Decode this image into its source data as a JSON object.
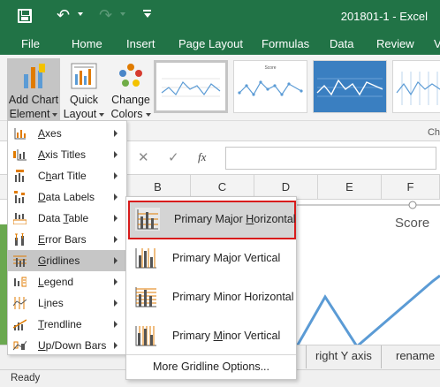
{
  "titlebar": {
    "doc_title": "201801-1 - Excel"
  },
  "tabs": [
    "File",
    "Home",
    "Insert",
    "Page Layout",
    "Formulas",
    "Data",
    "Review",
    "V"
  ],
  "ribbon": {
    "add_chart_line1": "Add Chart",
    "add_chart_line2": "Element",
    "quick_layout_line1": "Quick",
    "quick_layout_line2": "Layout",
    "change_colors_line1": "Change",
    "change_colors_line2": "Colors",
    "group_label_partial": "Ch",
    "chart_styles": [
      "style-1",
      "style-2",
      "style-3",
      "style-4"
    ],
    "style_thumb_title": "Score"
  },
  "formula_bar": {
    "cancel_symbol": "✕",
    "enter_symbol": "✓",
    "fx_label": "fx",
    "value": ""
  },
  "columns": [
    "B",
    "C",
    "D",
    "E",
    "F"
  ],
  "chart": {
    "title": "Score"
  },
  "sheet_tabs": [
    "right Y axis",
    "rename"
  ],
  "status": "Ready",
  "chart_element_menu": {
    "items": [
      {
        "label": "Axes",
        "mnemonic_index": 1
      },
      {
        "label": "Axis Titles",
        "mnemonic_index": 1
      },
      {
        "label": "Chart Title",
        "mnemonic_index": 1
      },
      {
        "label": "Data Labels",
        "mnemonic_index": 1
      },
      {
        "label": "Data Table",
        "mnemonic_index": 6
      },
      {
        "label": "Error Bars",
        "mnemonic_index": 1
      },
      {
        "label": "Gridlines",
        "mnemonic_index": 1
      },
      {
        "label": "Legend",
        "mnemonic_index": 1
      },
      {
        "label": "Lines",
        "mnemonic_index": 1
      },
      {
        "label": "Trendline",
        "mnemonic_index": 1
      },
      {
        "label": "Up/Down Bars",
        "mnemonic_index": 0
      }
    ],
    "hovered": "Gridlines"
  },
  "gridlines_submenu": {
    "items": [
      {
        "label": "Primary Major Horizontal",
        "underline": "Horizontal",
        "selected": true
      },
      {
        "label": "Primary Major Vertical",
        "underline": "",
        "selected": false
      },
      {
        "label": "Primary Minor Horizontal",
        "underline": "",
        "selected": false
      },
      {
        "label": "Primary Minor Vertical",
        "underline": "Minor",
        "selected": false
      }
    ],
    "more_label": "More Gridline Options..."
  },
  "colors": {
    "excel_green": "#217346",
    "highlight_red": "#d81b1b",
    "series_blue": "#5b9bd5",
    "icon_orange": "#e07b00"
  }
}
